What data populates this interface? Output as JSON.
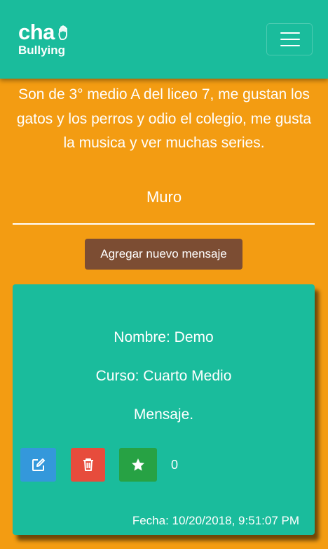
{
  "header": {
    "logo_line1": "cha",
    "logo_line2": "Bullying",
    "menu_icon": "hamburger-menu-icon"
  },
  "profile": {
    "bio": "Son de 3° medio A del liceo 7, me gustan los gatos y los perros y odio el colegio, me gusta la musica y ver muchas series."
  },
  "wall": {
    "title": "Muro",
    "add_button_label": "Agregar nuevo mensaje"
  },
  "message": {
    "nombre": "Nombre: Demo",
    "curso": "Curso: Cuarto Medio",
    "mensaje": "Mensaje.",
    "likes": "0",
    "fecha": "Fecha: 10/20/2018, 9:51:07 PM",
    "actions": {
      "edit_icon": "edit-icon",
      "delete_icon": "trash-icon",
      "like_icon": "star-icon"
    }
  },
  "colors": {
    "background": "#f39c12",
    "navbar": "#1abc9c",
    "card": "#1abc9c",
    "add_button": "#7c4d33",
    "edit": "#3498db",
    "delete": "#e74c3c",
    "like": "#27a244"
  }
}
